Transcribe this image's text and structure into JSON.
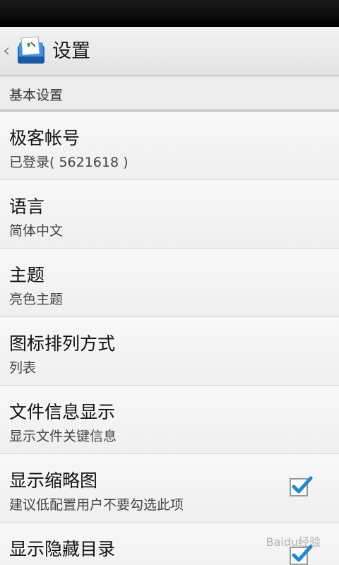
{
  "header": {
    "title": "设置"
  },
  "section": {
    "label": "基本设置"
  },
  "settings": [
    {
      "title": "极客帐号",
      "subtitle": "已登录( 5621618 )"
    },
    {
      "title": "语言",
      "subtitle": "简体中文"
    },
    {
      "title": "主题",
      "subtitle": "亮色主题"
    },
    {
      "title": "图标排列方式",
      "subtitle": "列表"
    },
    {
      "title": "文件信息显示",
      "subtitle": "显示文件关键信息"
    },
    {
      "title": "显示缩略图",
      "subtitle": "建议低配置用户不要勾选此项",
      "checked": true
    },
    {
      "title": "显示隐藏目录",
      "subtitle": "",
      "checked": true
    }
  ],
  "watermark": "Baidu经验",
  "colors": {
    "check_accent": "#1e88d8"
  }
}
